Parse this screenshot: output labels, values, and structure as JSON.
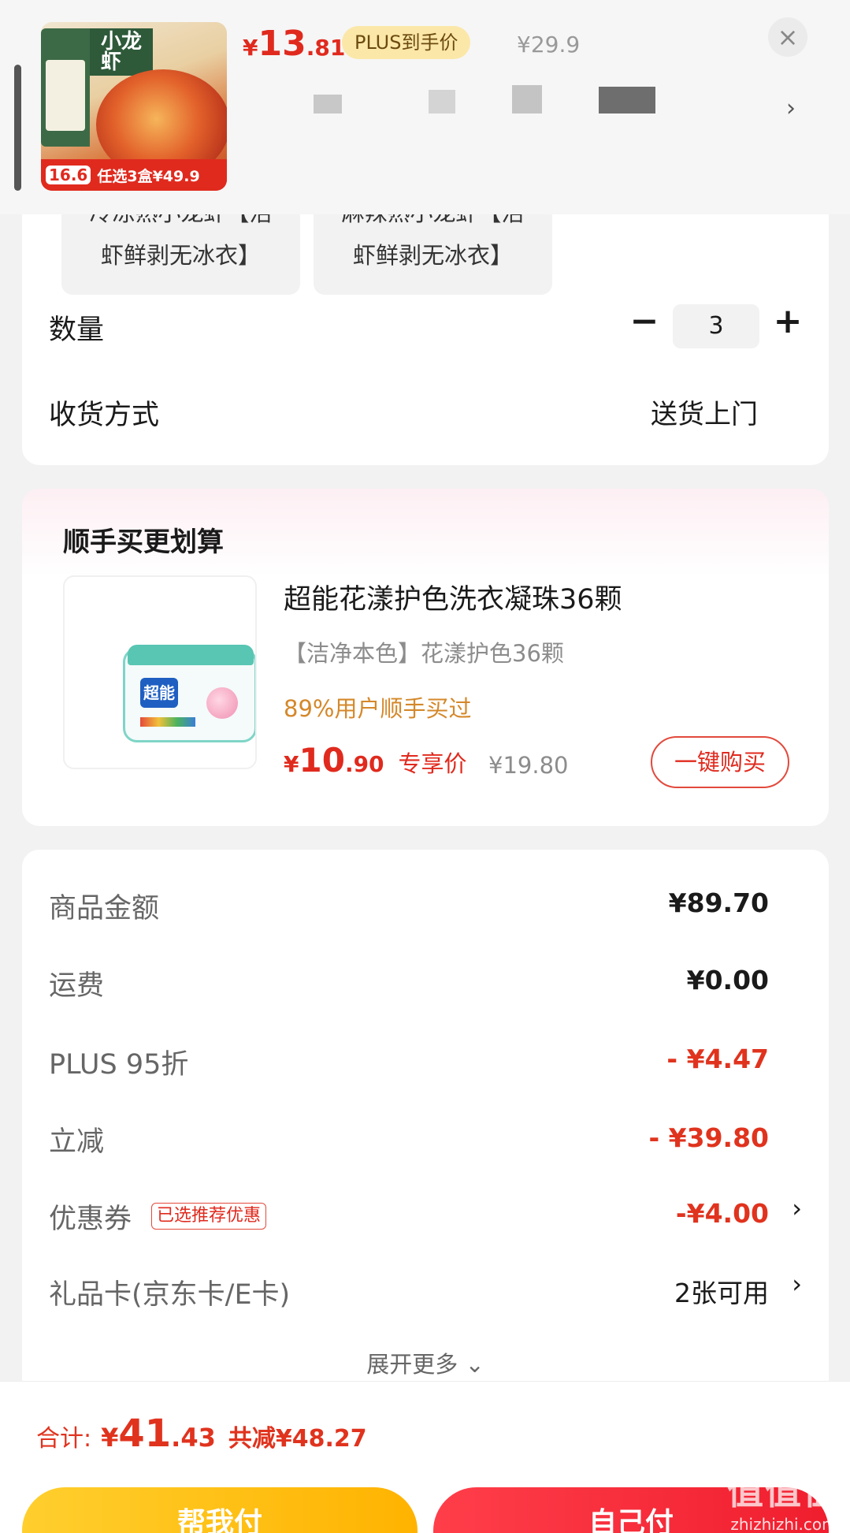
{
  "header": {
    "price_currency": "¥",
    "price_int": "13",
    "price_dec": ".81",
    "plus_tag": "PLUS到手价",
    "original_price": "¥29.9",
    "close": "×",
    "chevron": "›",
    "thumb_title": "小龙虾",
    "thumb_badge_num": "16.6",
    "thumb_badge_text": "任选3盒¥49.9"
  },
  "spec": {
    "chips": [
      {
        "line": "虾鲜剥无冰衣】"
      },
      {
        "line": "虾鲜剥无冰衣】"
      }
    ]
  },
  "quantity": {
    "label": "数量",
    "minus": "−",
    "value": "3",
    "plus": "+"
  },
  "delivery": {
    "label": "收货方式",
    "value": "送货上门"
  },
  "recommend": {
    "title": "顺手买更划算",
    "product_name": "超能花漾护色洗衣凝珠36颗",
    "spec": "【洁净本色】花漾护色36颗",
    "hint": "89%用户顺手买过",
    "price_currency": "¥",
    "price_int": "10",
    "price_dec": ".90",
    "price_tag": "专享价",
    "original_price": "¥19.80",
    "buy_label": "一键购买",
    "brand_text": "超能"
  },
  "summary": {
    "rows": [
      {
        "label": "商品金额",
        "value": "¥89.70"
      },
      {
        "label": "运费",
        "value": "¥0.00"
      },
      {
        "label": "PLUS 95折",
        "value": "- ¥4.47"
      },
      {
        "label": "立减",
        "value": "- ¥39.80"
      },
      {
        "label": "优惠券",
        "value": "-¥4.00",
        "tag": "已选推荐优惠"
      },
      {
        "label": "礼品卡(京东卡/E卡)",
        "value": "2张可用"
      }
    ],
    "chevron": "›",
    "expand_label": "展开更多 ⌄"
  },
  "bottom": {
    "total_label": "合计:",
    "total_currency": "¥",
    "total_int": "41",
    "total_dec": ".43",
    "saved": "共减¥48.27",
    "help_pay": "帮我付",
    "self_pay": "自己付"
  },
  "watermark": {
    "logo": "值值值",
    "url": "zhizhizhi.com"
  },
  "colors": {
    "price_red": "#e02a1e",
    "plus_bg": "#fbe7a8",
    "help_btn": "#ffbf1f",
    "self_btn": "#f01e2e",
    "hint_orange": "#d4882a"
  }
}
